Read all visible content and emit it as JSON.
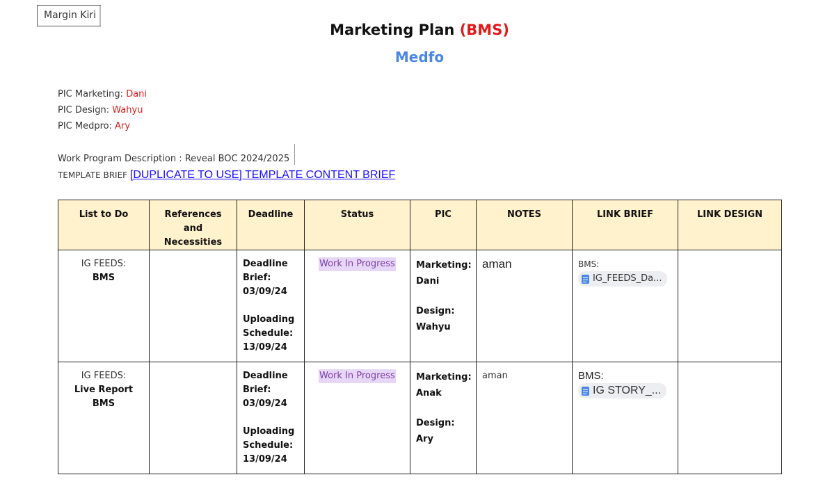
{
  "margin_tag": "Margin Kiri",
  "title": {
    "main": "Marketing Plan ",
    "accent": "(BMS)"
  },
  "subtitle": "Medfo",
  "pics": [
    {
      "label": "PIC Marketing: ",
      "name": "Dani"
    },
    {
      "label": "PIC Design: ",
      "name": "Wahyu"
    },
    {
      "label": "PIC Medpro: ",
      "name": "Ary"
    }
  ],
  "description": "Work Program Description : Reveal BOC 2024/2025",
  "brief": {
    "label": "TEMPLATE BRIEF ",
    "link_text": "[DUPLICATE TO USE] TEMPLATE CONTENT BRIEF"
  },
  "colors": {
    "accent_red": "#e0191a",
    "subtitle_blue": "#4a86e8",
    "header_bg": "#fff2cc",
    "status_bg": "#e7d6f5",
    "status_text": "#7a3fa8"
  },
  "table": {
    "headers": [
      "List to Do",
      "References and Necessities",
      "Deadline",
      "Status",
      "PIC",
      "NOTES",
      "LINK BRIEF",
      "LINK DESIGN"
    ],
    "rows": [
      {
        "list_prefix": "IG FEEDS:",
        "list_name": "BMS",
        "references": "",
        "deadline_brief_label": "Deadline Brief:",
        "deadline_brief_date": "03/09/24",
        "upload_label": "Uploading Schedule:",
        "upload_date": "13/09/24",
        "status": "Work In Progress",
        "pic_marketing_label": "Marketing:",
        "pic_marketing": "Dani",
        "pic_design_label": "Design:",
        "pic_design": "Wahyu",
        "notes": "aman",
        "link_brief_label": "BMS:",
        "link_brief_chip": "IG_FEEDS_Da...",
        "link_brief_icon": "google-docs-icon",
        "link_design": ""
      },
      {
        "list_prefix": "IG FEEDS:",
        "list_name": "Live Report BMS",
        "references": "",
        "deadline_brief_label": "Deadline Brief:",
        "deadline_brief_date": "03/09/24",
        "upload_label": "Uploading Schedule:",
        "upload_date": "13/09/24",
        "status": "Work In Progress",
        "pic_marketing_label": "Marketing:",
        "pic_marketing": "Anak",
        "pic_design_label": "Design:",
        "pic_design": "Ary",
        "notes": "aman",
        "link_brief_label": "BMS:",
        "link_brief_chip": "IG STORY_...",
        "link_brief_icon": "google-docs-icon",
        "link_design": ""
      }
    ]
  }
}
